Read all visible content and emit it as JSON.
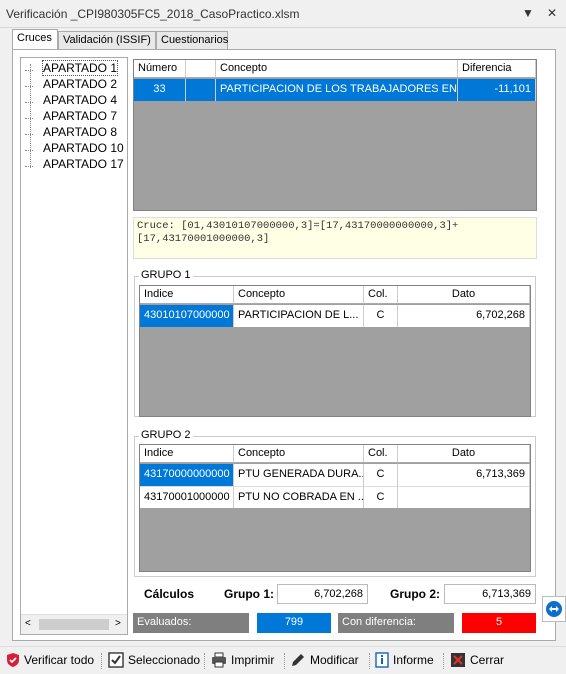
{
  "window": {
    "title": "Verificación _CPI980305FC5_2018_CasoPractico.xlsm"
  },
  "tabs": [
    {
      "label": "Cruces"
    },
    {
      "label": "Validación (ISSIF)"
    },
    {
      "label": "Cuestionarios"
    }
  ],
  "tree": {
    "items": [
      "APARTADO 1",
      "APARTADO 2",
      "APARTADO 4",
      "APARTADO 7",
      "APARTADO 8",
      "APARTADO 10",
      "APARTADO 17"
    ]
  },
  "main_grid": {
    "headers": [
      "Número",
      "Concepto",
      "Diferencia"
    ],
    "rows": [
      {
        "numero": "33",
        "concepto": "PARTICIPACION DE LOS TRABAJADORES EN ...",
        "diferencia": "-11,101"
      }
    ]
  },
  "formula": {
    "text": "Cruce: [01,43010107000000,3]=[17,43170000000000,3]+[17,43170001000000,3]"
  },
  "grupo1": {
    "label": "GRUPO 1",
    "headers": [
      "Indice",
      "Concepto",
      "Col.",
      "Dato"
    ],
    "rows": [
      {
        "indice": "43010107000000",
        "concepto": "PARTICIPACION DE L...",
        "col": "C",
        "dato": "6,702,268"
      }
    ]
  },
  "grupo2": {
    "label": "GRUPO 2",
    "headers": [
      "Indice",
      "Concepto",
      "Col.",
      "Dato"
    ],
    "rows": [
      {
        "indice": "43170000000000",
        "concepto": "PTU GENERADA DURA...",
        "col": "C",
        "dato": "6,713,369"
      },
      {
        "indice": "43170001000000",
        "concepto": "PTU NO COBRADA EN ...",
        "col": "C",
        "dato": ""
      }
    ]
  },
  "calculos": {
    "label": "Cálculos",
    "grupo1_label": "Grupo 1:",
    "grupo1_value": "6,702,268",
    "grupo2_label": "Grupo 2:",
    "grupo2_value": "6,713,369"
  },
  "status": {
    "evaluados_label": "Evaluados:",
    "evaluados_value": "799",
    "con_diferencia_label": "Con diferencia:",
    "con_diferencia_value": "5",
    "colors": {
      "gray": "#7f7f7f",
      "blue": "#0078d7",
      "red": "#ff0000"
    }
  },
  "toolbar": {
    "verificar_todo": "Verificar todo",
    "seleccionado": "Seleccionado",
    "imprimir": "Imprimir",
    "modificar": "Modificar",
    "informe": "Informe",
    "cerrar": "Cerrar"
  }
}
